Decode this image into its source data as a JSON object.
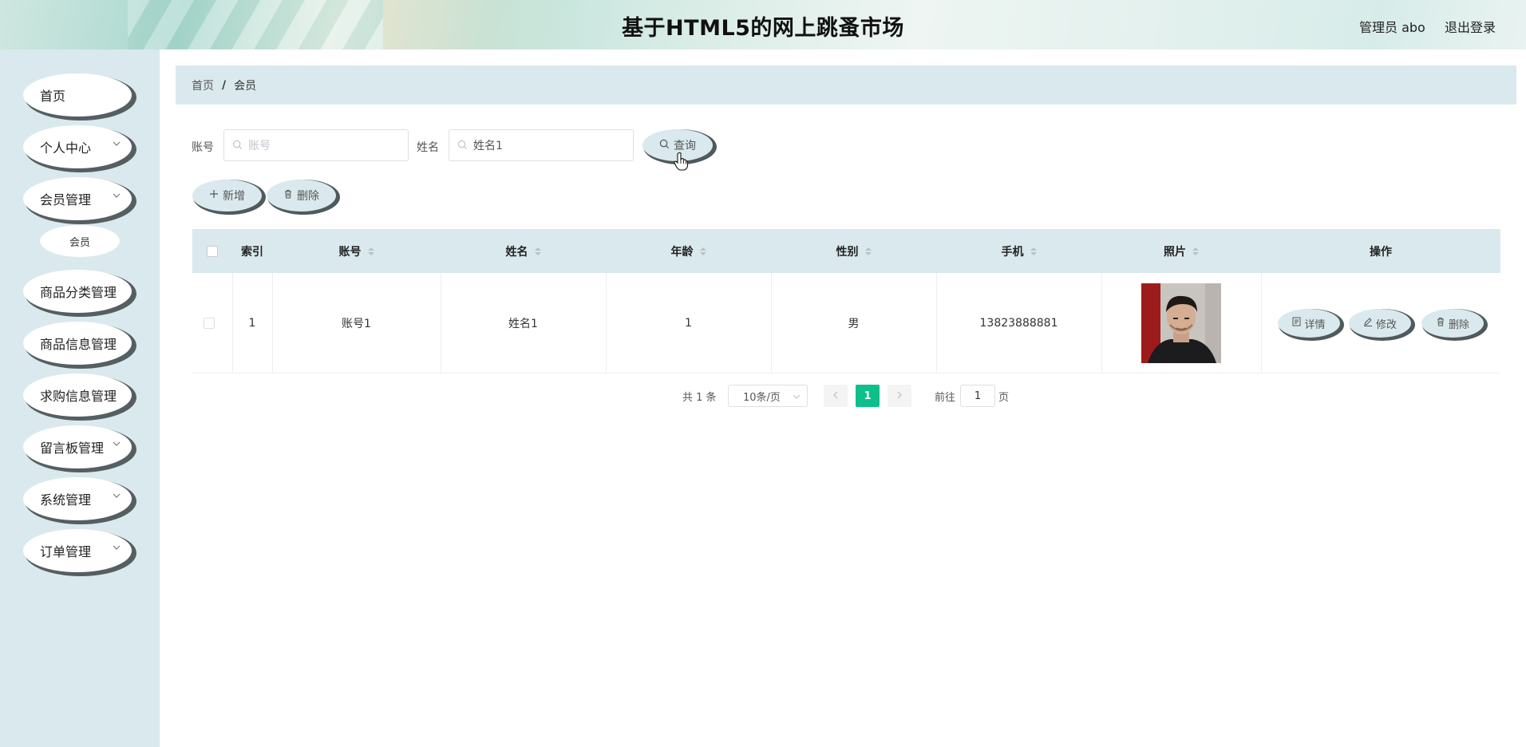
{
  "header": {
    "title": "基于HTML5的网上跳蚤市场",
    "admin_label": "管理员 abo",
    "logout": "退出登录"
  },
  "sidebar": {
    "items": [
      {
        "label": "首页"
      },
      {
        "label": "个人中心"
      },
      {
        "label": "会员管理"
      },
      {
        "label": "会员"
      },
      {
        "label": "商品分类管理"
      },
      {
        "label": "商品信息管理"
      },
      {
        "label": "求购信息管理"
      },
      {
        "label": "留言板管理"
      },
      {
        "label": "系统管理"
      },
      {
        "label": "订单管理"
      }
    ]
  },
  "breadcrumb": {
    "home": "首页",
    "separator": "/",
    "current": "会员"
  },
  "search": {
    "account_label": "账号",
    "account_placeholder": "账号",
    "name_label": "姓名",
    "name_value": "姓名1",
    "query_button": "查询"
  },
  "actions": {
    "add": "新增",
    "delete": "删除"
  },
  "table": {
    "headers": {
      "index": "索引",
      "account": "账号",
      "name": "姓名",
      "age": "年龄",
      "gender": "性别",
      "phone": "手机",
      "photo": "照片",
      "ops": "操作"
    },
    "rows": [
      {
        "index": "1",
        "account": "账号1",
        "name": "姓名1",
        "age": "1",
        "gender": "男",
        "phone": "13823888881"
      }
    ],
    "row_buttons": {
      "detail": "详情",
      "edit": "修改",
      "delete": "删除"
    }
  },
  "pagination": {
    "total": "共 1 条",
    "page_size": "10条/页",
    "current_page": "1",
    "goto": "前往",
    "goto_value": "1",
    "page_unit": "页"
  },
  "colors": {
    "accent": "#0fbf8b",
    "panel": "#dae9ed",
    "button_shadow": "#4e5a5d"
  }
}
